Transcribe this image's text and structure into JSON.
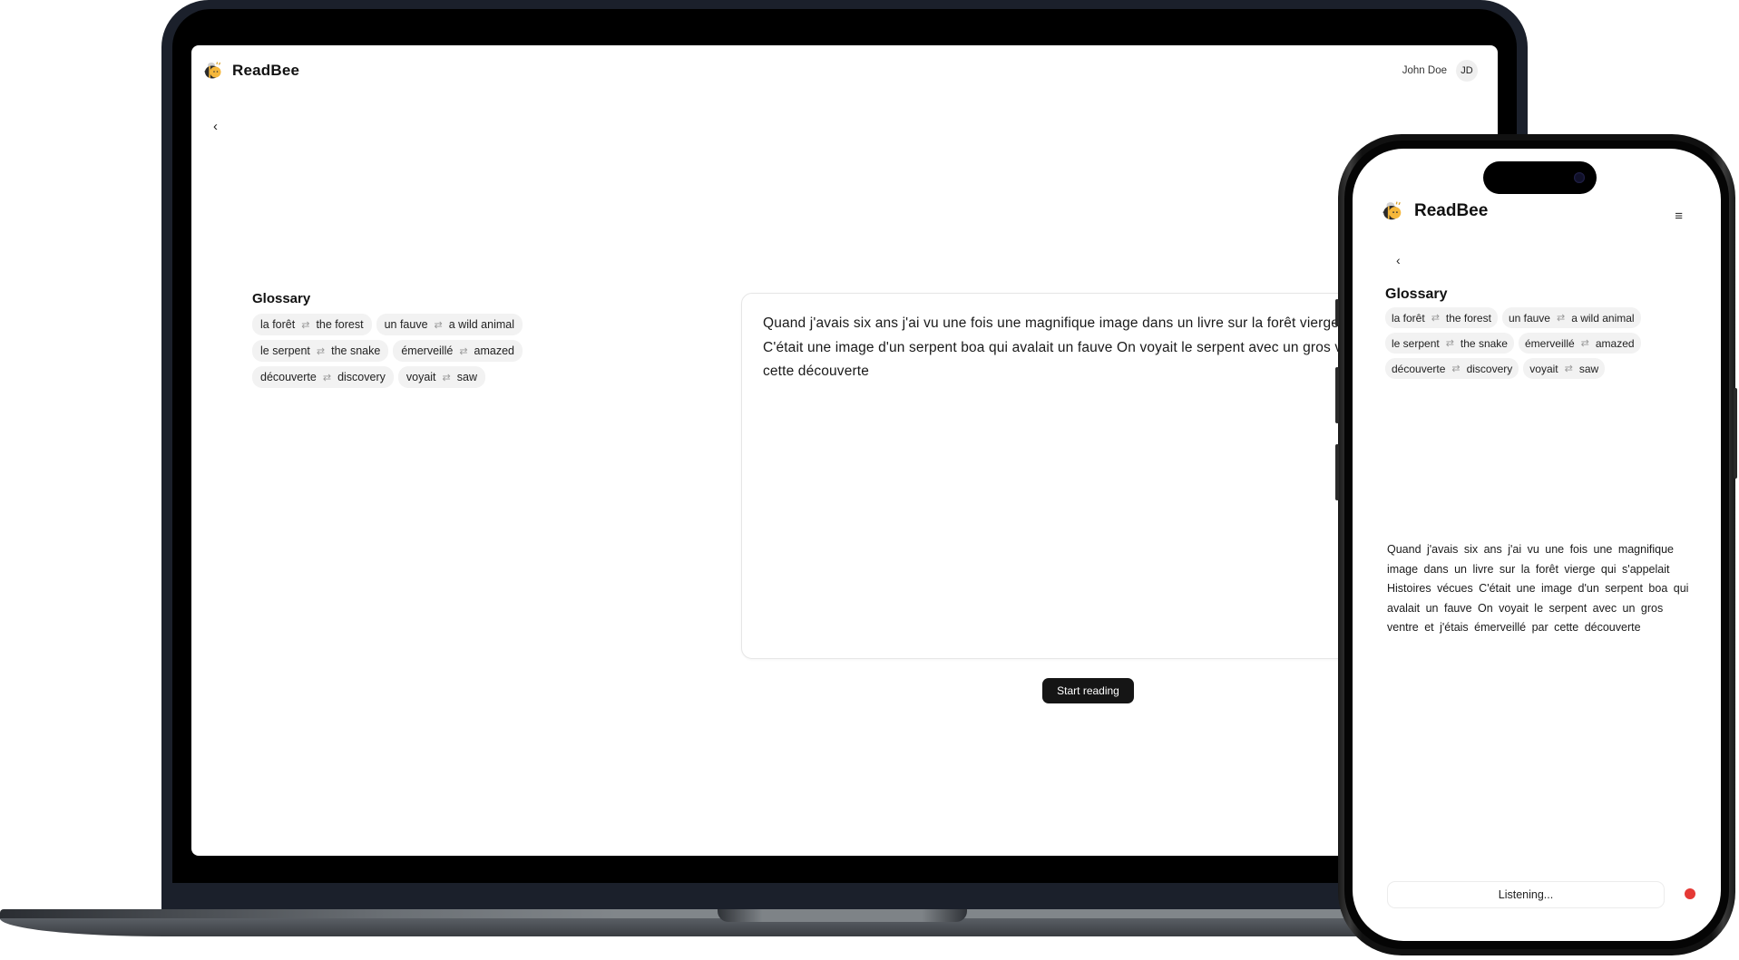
{
  "app": {
    "name": "ReadBee",
    "logo_icon": "bee-icon"
  },
  "colors": {
    "accent_dark": "#151515",
    "chip_bg": "#f2f2f2",
    "recording": "#e53935",
    "bee_yellow": "#f5b73b"
  },
  "desktop": {
    "user": {
      "name": "John Doe",
      "initials": "JD"
    },
    "back_icon": "chevron-left-icon",
    "glossary": {
      "title": "Glossary",
      "swap_icon": "⇄",
      "entries": [
        {
          "source": "la forêt",
          "target": "the forest"
        },
        {
          "source": "un fauve",
          "target": "a wild animal"
        },
        {
          "source": "le serpent",
          "target": "the snake"
        },
        {
          "source": "émerveillé",
          "target": "amazed"
        },
        {
          "source": "découverte",
          "target": "discovery"
        },
        {
          "source": "voyait",
          "target": "saw"
        }
      ]
    },
    "text": "Quand j'avais six ans j'ai vu une fois une magnifique image dans un livre sur la forêt vierge qui s'appelait Histoires vécues C'était une image d'un serpent boa qui avalait un fauve On voyait le serpent avec un gros ventre et j'étais émerveillé par cette découverte",
    "start_button": "Start reading"
  },
  "mobile": {
    "menu_icon": "hamburger-menu-icon",
    "back_icon": "chevron-left-icon",
    "glossary": {
      "title": "Glossary",
      "entries": [
        {
          "source": "la forêt",
          "target": "the forest"
        },
        {
          "source": "un fauve",
          "target": "a wild animal"
        },
        {
          "source": "le serpent",
          "target": "the snake"
        },
        {
          "source": "émerveillé",
          "target": "amazed"
        },
        {
          "source": "découverte",
          "target": "discovery"
        },
        {
          "source": "voyait",
          "target": "saw"
        }
      ]
    },
    "text": "Quand j'avais six ans j'ai vu une fois une magnifique image dans un livre sur la forêt vierge qui s'appelait Histoires vécues C'était une image d'un serpent boa qui avalait un fauve On voyait le serpent avec un gros ventre et j'étais émerveillé par cette découverte",
    "status": "Listening...",
    "recording": true
  }
}
